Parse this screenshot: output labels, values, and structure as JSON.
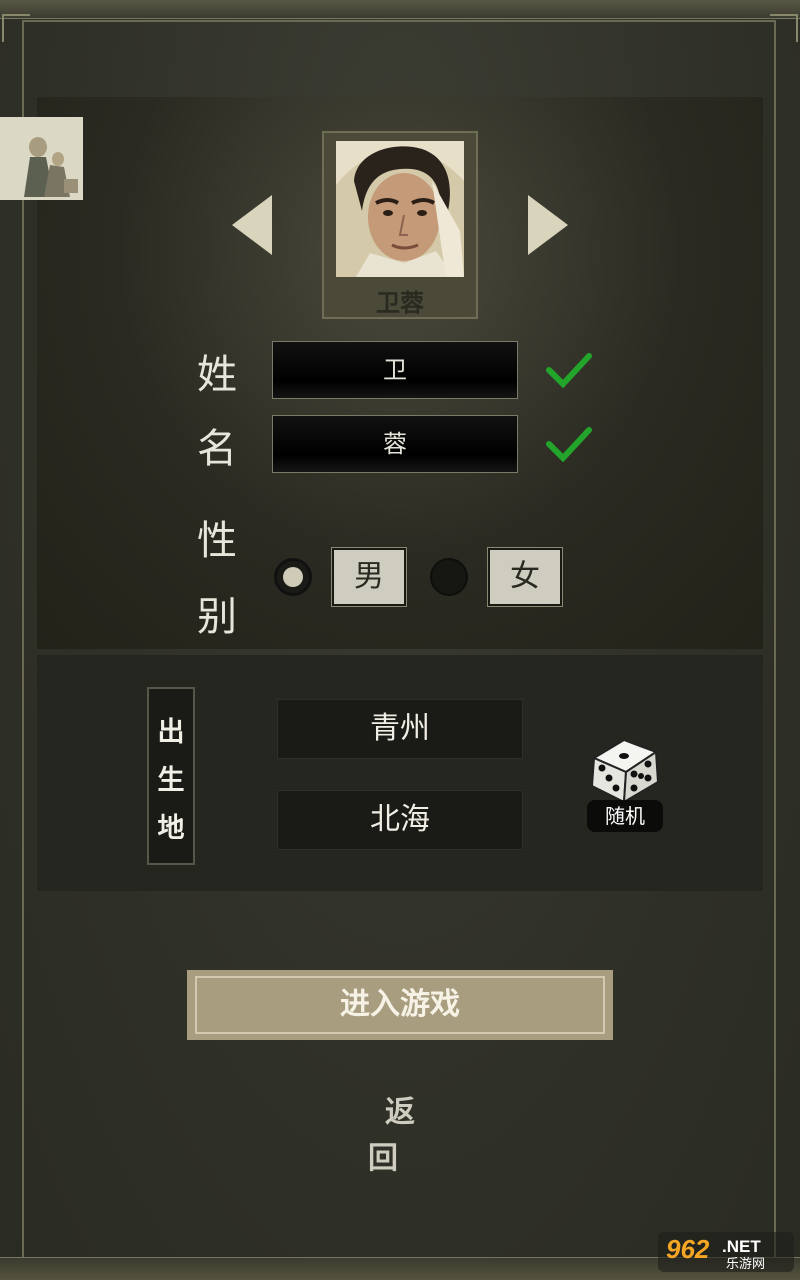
{
  "character": {
    "display_name": "卫蓉"
  },
  "form": {
    "surname_label": "姓",
    "surname_value": "卫",
    "given_label": "名",
    "given_value": "蓉",
    "gender_label_1": "性",
    "gender_label_2": "别",
    "gender_options": [
      "男",
      "女"
    ],
    "selected_gender": "男"
  },
  "birthplace": {
    "label_chars": [
      "出",
      "生",
      "地"
    ],
    "province": "青州",
    "city": "北海",
    "random_label": "随机"
  },
  "actions": {
    "enter_label": "进入游戏",
    "back_label": "返回"
  },
  "watermark": {
    "brand": "962",
    "suffix": ".NET",
    "sub": "乐游网"
  },
  "colors": {
    "check_green": "#22a52a",
    "enter_button": "#a99d80",
    "field_border": "#7b7a66"
  }
}
